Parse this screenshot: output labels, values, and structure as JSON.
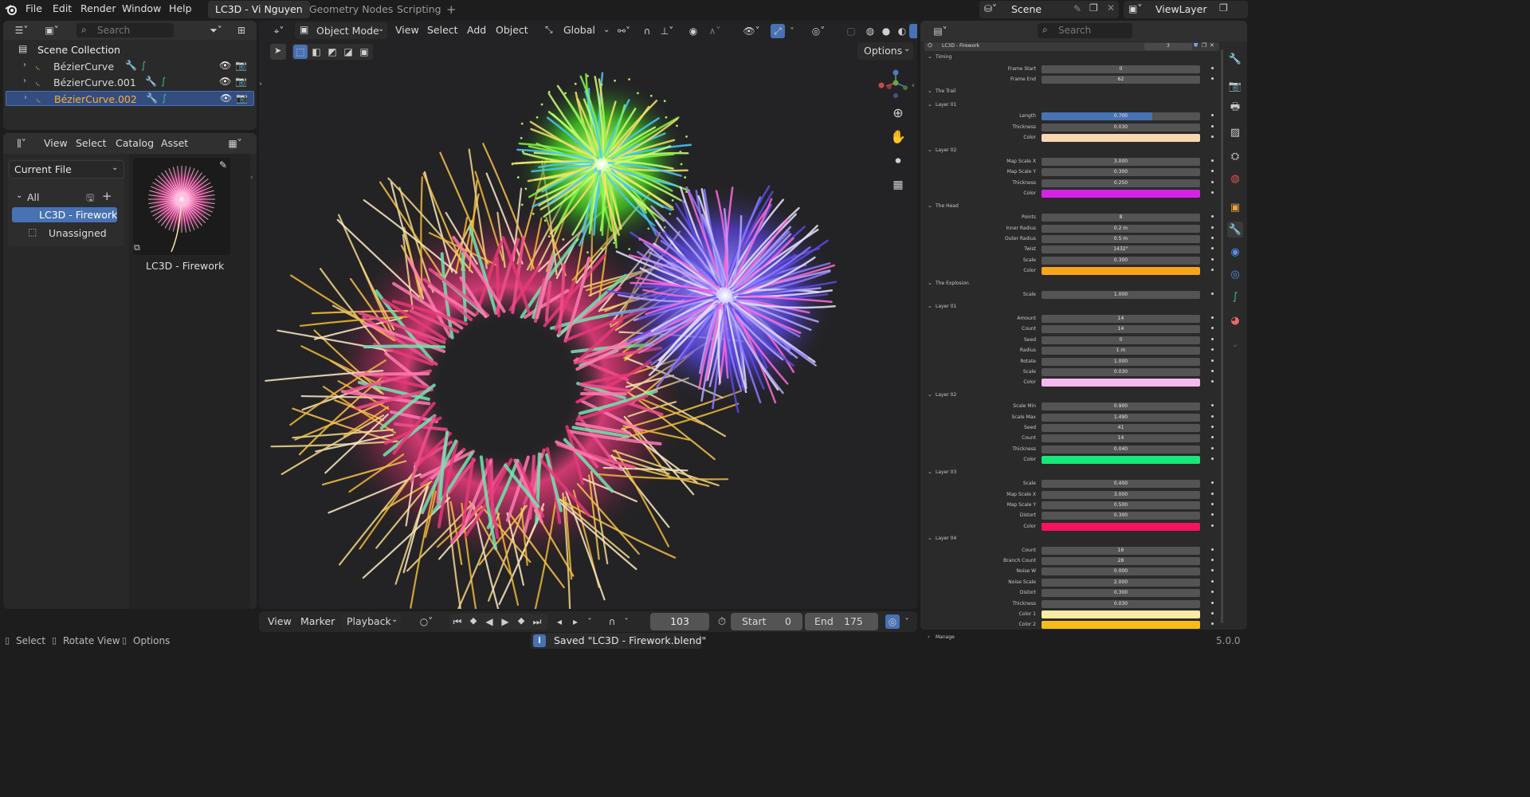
{
  "topbar": {
    "menus": [
      "File",
      "Edit",
      "Render",
      "Window",
      "Help"
    ],
    "tabs": [
      "LC3D - Vi Nguyen",
      "Geometry Nodes",
      "Scripting"
    ],
    "add_tab": "+",
    "scene": "Scene",
    "view_layer": "ViewLayer"
  },
  "outliner": {
    "search_placeholder": "Search",
    "collection": "Scene Collection",
    "items": [
      {
        "label": "BézierCurve",
        "selected": false
      },
      {
        "label": "BézierCurve.001",
        "selected": false
      },
      {
        "label": "BézierCurve.002",
        "selected": true
      }
    ]
  },
  "asset_browser": {
    "menus": [
      "View",
      "Select",
      "Catalog",
      "Asset"
    ],
    "library": "Current File",
    "catalog_all": "All",
    "catalog_items": [
      "LC3D - Firework",
      "Unassigned"
    ],
    "asset_name": "LC3D - Firework"
  },
  "viewport": {
    "mode": "Object Mode",
    "menus": [
      "View",
      "Select",
      "Add",
      "Object"
    ],
    "transform_orientation": "Global",
    "options": "Options"
  },
  "timeline": {
    "menus": [
      "View",
      "Marker",
      "Playback"
    ],
    "current_frame": "103",
    "start_label": "Start",
    "start": "0",
    "end_label": "End",
    "end": "175"
  },
  "statusbar": {
    "select": "Select",
    "rotate": "Rotate View",
    "options": "Options",
    "message": "Saved \"LC3D - Firework.blend\"",
    "version": "5.0.0"
  },
  "properties": {
    "search_placeholder": "Search",
    "modifier_name": "LC3D - Firework",
    "users": "3",
    "rows": [
      {
        "type": "section",
        "label": "Timing"
      },
      {
        "type": "prop",
        "label": "Frame Start",
        "value": "0"
      },
      {
        "type": "prop",
        "label": "Frame End",
        "value": "62"
      },
      {
        "type": "section",
        "label": "The Trail"
      },
      {
        "type": "section",
        "label": "Layer 01"
      },
      {
        "type": "prop",
        "label": "Length",
        "value": "0.700",
        "fill": 0.7
      },
      {
        "type": "prop",
        "label": "Thickness",
        "value": "0.030"
      },
      {
        "type": "color",
        "label": "Color",
        "color": "#f9d7b3"
      },
      {
        "type": "section",
        "label": "Layer 02"
      },
      {
        "type": "prop",
        "label": "Map Scale X",
        "value": "3.000"
      },
      {
        "type": "prop",
        "label": "Map Scale Y",
        "value": "0.300"
      },
      {
        "type": "prop",
        "label": "Thickness",
        "value": "0.250"
      },
      {
        "type": "color",
        "label": "Color",
        "color": "#d523e6"
      },
      {
        "type": "section",
        "label": "The Head"
      },
      {
        "type": "prop",
        "label": "Points",
        "value": "8"
      },
      {
        "type": "prop",
        "label": "Inner Radius",
        "value": "0.2 m"
      },
      {
        "type": "prop",
        "label": "Outer Radius",
        "value": "0.5 m"
      },
      {
        "type": "prop",
        "label": "Twist",
        "value": "1432°"
      },
      {
        "type": "prop",
        "label": "Scale",
        "value": "0.300"
      },
      {
        "type": "color",
        "label": "Color",
        "color": "#f8a51a"
      },
      {
        "type": "section",
        "label": "The Explosion"
      },
      {
        "type": "prop",
        "label": "Scale",
        "value": "1.000"
      },
      {
        "type": "section",
        "label": "Layer 01"
      },
      {
        "type": "prop",
        "label": "Amount",
        "value": "14"
      },
      {
        "type": "prop",
        "label": "Count",
        "value": "14"
      },
      {
        "type": "prop",
        "label": "Seed",
        "value": "0"
      },
      {
        "type": "prop",
        "label": "Radius",
        "value": "1 m"
      },
      {
        "type": "prop",
        "label": "Rotate",
        "value": "1.000"
      },
      {
        "type": "prop",
        "label": "Scale",
        "value": "0.030"
      },
      {
        "type": "color",
        "label": "Color",
        "color": "#f7b9ef"
      },
      {
        "type": "section",
        "label": "Layer 02"
      },
      {
        "type": "prop",
        "label": "Scale Min",
        "value": "0.900"
      },
      {
        "type": "prop",
        "label": "Scale Max",
        "value": "1.490"
      },
      {
        "type": "prop",
        "label": "Seed",
        "value": "41"
      },
      {
        "type": "prop",
        "label": "Count",
        "value": "14"
      },
      {
        "type": "prop",
        "label": "Thickness",
        "value": "0.040"
      },
      {
        "type": "color",
        "label": "Color",
        "color": "#16e879"
      },
      {
        "type": "section",
        "label": "Layer 03"
      },
      {
        "type": "prop",
        "label": "Scale",
        "value": "0.400"
      },
      {
        "type": "prop",
        "label": "Map Scale X",
        "value": "3.000"
      },
      {
        "type": "prop",
        "label": "Map Scale Y",
        "value": "0.500"
      },
      {
        "type": "prop",
        "label": "Distort",
        "value": "0.300"
      },
      {
        "type": "color",
        "label": "Color",
        "color": "#f6125e"
      },
      {
        "type": "section",
        "label": "Layer 04"
      },
      {
        "type": "prop",
        "label": "Count",
        "value": "16"
      },
      {
        "type": "prop",
        "label": "Branch Count",
        "value": "28"
      },
      {
        "type": "prop",
        "label": "Noise W",
        "value": "0.000"
      },
      {
        "type": "prop",
        "label": "Noise Scale",
        "value": "2.000"
      },
      {
        "type": "prop",
        "label": "Distort",
        "value": "0.300"
      },
      {
        "type": "prop",
        "label": "Thickness",
        "value": "0.030"
      },
      {
        "type": "color",
        "label": "Color 1",
        "color": "#fbeaa7"
      },
      {
        "type": "color",
        "label": "Color 2",
        "color": "#f8bc18"
      },
      {
        "type": "section",
        "label": "Manage",
        "collapsed": true
      }
    ]
  },
  "colors": {
    "accent": "#4772b3",
    "selected_text": "#ffaf29",
    "bg": "#1d1d1d",
    "panel": "#2a2a2a",
    "viewport": "#232325"
  }
}
